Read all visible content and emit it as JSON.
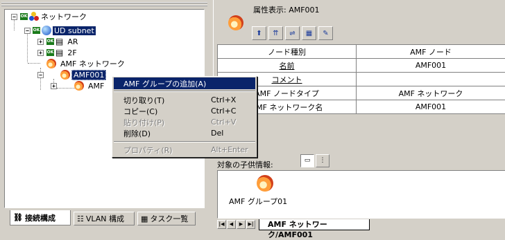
{
  "tree": {
    "root": "ネットワーク",
    "subnet": "UD subnet",
    "ar": "AR",
    "two_f": "2F",
    "amf_network": "AMF ネットワーク",
    "amf001": "AMF001",
    "amf_child": "AMF"
  },
  "left_tabs": [
    "接続構成",
    "VLAN 構成",
    "タスク一覧"
  ],
  "context_menu": {
    "items": [
      {
        "label": "AMF グループの追加(A)",
        "shortcut": ""
      },
      {
        "label": "切り取り(T)",
        "shortcut": "Ctrl+X"
      },
      {
        "label": "コピー(C)",
        "shortcut": "Ctrl+C"
      },
      {
        "label": "貼り付け(P)",
        "shortcut": "Ctrl+V"
      },
      {
        "label": "削除(D)",
        "shortcut": "Del"
      },
      {
        "label": "プロパティ(R)",
        "shortcut": "Alt+Enter"
      }
    ]
  },
  "props": {
    "title": "属性表示: AMF001",
    "rows": [
      {
        "key": "ノード種別",
        "value": "AMF ノード"
      },
      {
        "key": "名前",
        "value": "AMF001"
      },
      {
        "key": "コメント",
        "value": ""
      },
      {
        "key": "AMF ノードタイプ",
        "value": "AMF ネットワーク"
      },
      {
        "key": "AMF ネットワーク名",
        "value": "AMF001"
      }
    ]
  },
  "children": {
    "label": "対象の子供情報:",
    "item": "AMF グループ01"
  },
  "bottom_tab": "AMF ネットワーク/AMF001",
  "colors": {
    "selection": "#0a246a",
    "face": "#d4d0c8",
    "ok_badge": "#1a7a1a"
  }
}
